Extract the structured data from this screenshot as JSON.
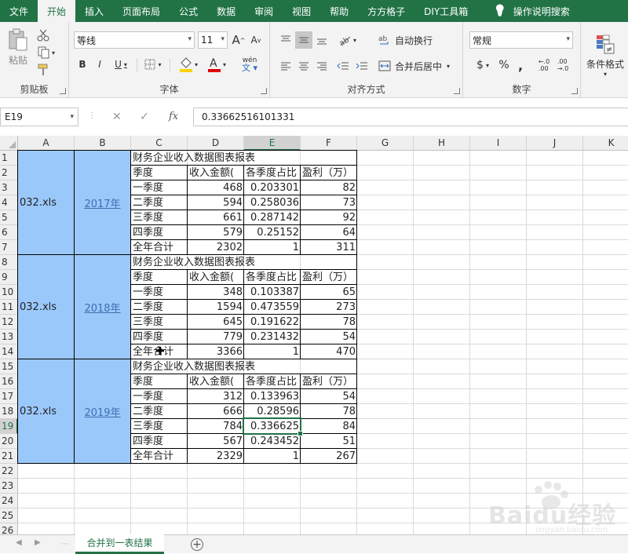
{
  "ribbon_tabs": [
    "文件",
    "开始",
    "插入",
    "页面布局",
    "公式",
    "数据",
    "审阅",
    "视图",
    "帮助",
    "方方格子",
    "DIY工具箱",
    "操作说明搜索"
  ],
  "active_tab": "开始",
  "clipboard": {
    "paste_label": "粘贴",
    "group_label": "剪贴板"
  },
  "font": {
    "name": "等线",
    "size": "11",
    "group_label": "字体",
    "bold": "B",
    "italic": "I",
    "underline": "U",
    "grow": "A",
    "shrink": "A",
    "phonetic": "wén"
  },
  "alignment": {
    "wrap_label": "自动换行",
    "merge_label": "合并后居中",
    "group_label": "对齐方式"
  },
  "number": {
    "format": "常规",
    "group_label": "数字",
    "currency": "$",
    "percent": "%",
    "comma": ","
  },
  "styles": {
    "cond_format_label": "条件格式"
  },
  "colors": {
    "brand": "#217346",
    "accent_fill": "#9bc8fb",
    "link": "#3c6fae"
  },
  "name_box": "E19",
  "formula_value": "0.33662516101331",
  "formula_icons": {
    "cancel": "✕",
    "enter": "✓",
    "fx": "fx"
  },
  "columns": [
    "A",
    "B",
    "C",
    "D",
    "E",
    "F",
    "G",
    "H",
    "I",
    "J",
    "K"
  ],
  "rows": [
    "1",
    "2",
    "3",
    "4",
    "5",
    "6",
    "7",
    "8",
    "9",
    "10",
    "11",
    "12",
    "13",
    "14",
    "15",
    "16",
    "17",
    "18",
    "19",
    "20",
    "21",
    "22",
    "23",
    "24",
    "25",
    "26"
  ],
  "blocks": [
    {
      "file": "032.xls",
      "year": "2017年",
      "title": "财务企业收入数据图表报表",
      "headers": [
        "季度",
        "收入金额(",
        "各季度占比",
        "盈利（万）"
      ],
      "rows": [
        [
          "一季度",
          "468",
          "0.203301",
          "82"
        ],
        [
          "二季度",
          "594",
          "0.258036",
          "73"
        ],
        [
          "三季度",
          "661",
          "0.287142",
          "92"
        ],
        [
          "四季度",
          "579",
          "0.25152",
          "64"
        ],
        [
          "全年合计",
          "2302",
          "1",
          "311"
        ]
      ]
    },
    {
      "file": "032.xls",
      "year": "2018年",
      "title": "财务企业收入数据图表报表",
      "headers": [
        "季度",
        "收入金额(",
        "各季度占比",
        "盈利（万）"
      ],
      "rows": [
        [
          "一季度",
          "348",
          "0.103387",
          "65"
        ],
        [
          "二季度",
          "1594",
          "0.473559",
          "273"
        ],
        [
          "三季度",
          "645",
          "0.191622",
          "78"
        ],
        [
          "四季度",
          "779",
          "0.231432",
          "54"
        ],
        [
          "全年合计",
          "3366",
          "1",
          "470"
        ]
      ]
    },
    {
      "file": "032.xls",
      "year": "2019年",
      "title": "财务企业收入数据图表报表",
      "headers": [
        "季度",
        "收入金额(",
        "各季度占比",
        "盈利（万）"
      ],
      "rows": [
        [
          "一季度",
          "312",
          "0.133963",
          "54"
        ],
        [
          "二季度",
          "666",
          "0.28596",
          "78"
        ],
        [
          "三季度",
          "784",
          "0.336625",
          "84"
        ],
        [
          "四季度",
          "567",
          "0.243452",
          "51"
        ],
        [
          "全年合计",
          "2329",
          "1",
          "267"
        ]
      ]
    }
  ],
  "sheet_tab": "合并到一表结果",
  "add_sheet": "+",
  "watermark": {
    "text": "Baidu经验",
    "sub": "jingyan.baidu.com"
  }
}
